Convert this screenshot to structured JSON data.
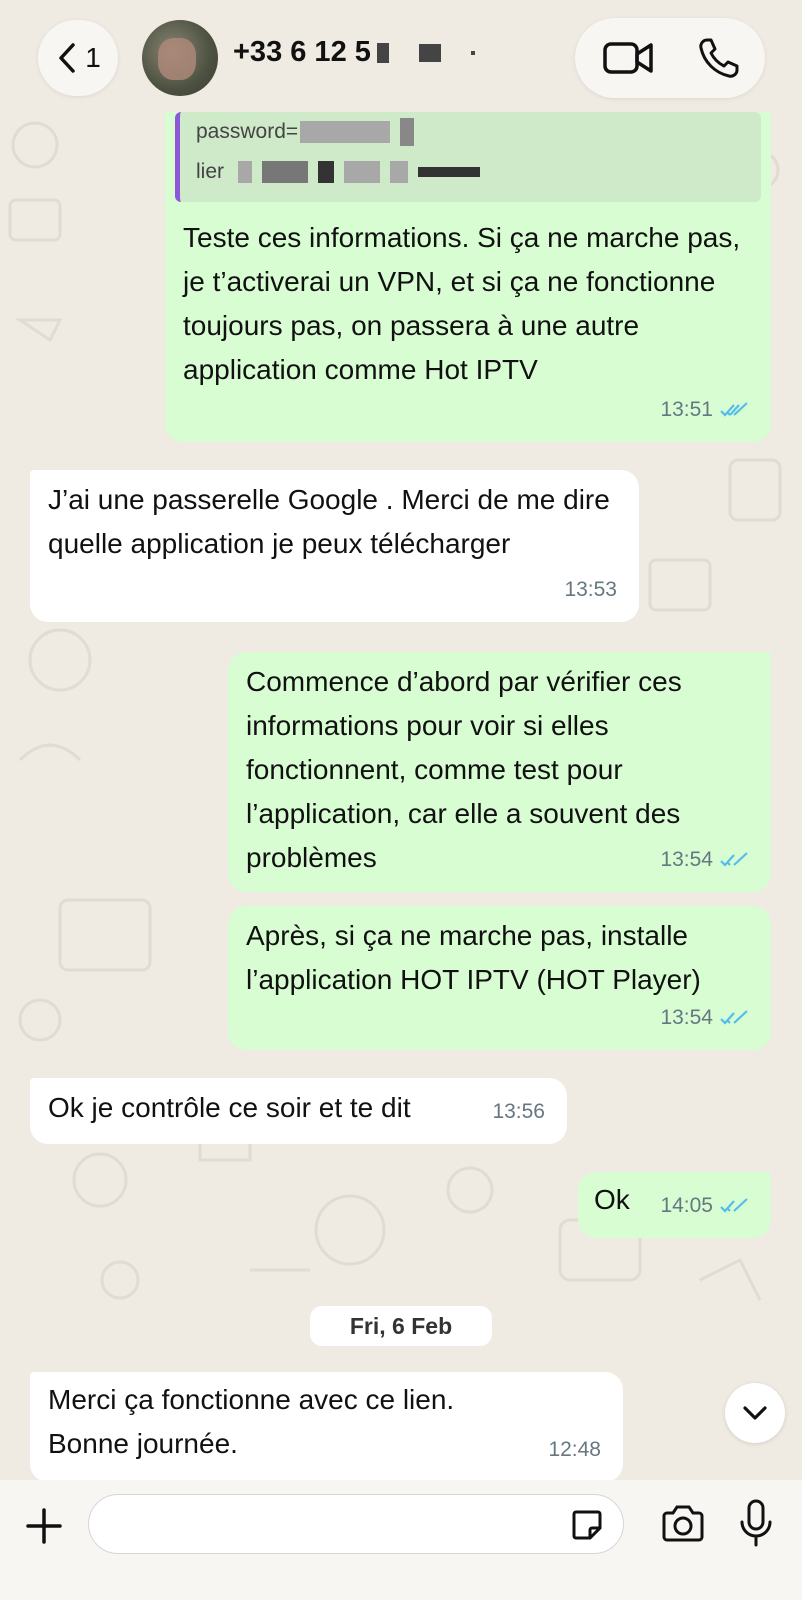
{
  "header": {
    "back_count": "1",
    "contact_phone": "+33 6 12 5"
  },
  "messages": [
    {
      "id": "m1",
      "quoted_lines": [
        "password=",
        "lier"
      ],
      "text": "Teste ces informations. Si ça ne marche pas, je t’activerai un VPN, et si ça ne fonctionne toujours pas, on passera à une autre application comme Hot IPTV",
      "time": "13:51",
      "direction": "outgoing"
    },
    {
      "id": "m2",
      "text": "J’ai une passerelle Google . Merci de me dire quelle application je peux télécharger",
      "time": "13:53",
      "direction": "incoming"
    },
    {
      "id": "m3",
      "text": "Commence d’abord par vérifier ces informations pour voir si elles fonctionnent, comme test pour l’application, car elle a souvent des problèmes",
      "time": "13:54",
      "direction": "outgoing"
    },
    {
      "id": "m4",
      "text": "Après, si ça ne marche pas, installe l’application HOT IPTV (HOT Player)",
      "time": "13:54",
      "direction": "outgoing"
    },
    {
      "id": "m5",
      "text": "Ok je contrôle ce soir et te dit",
      "time": "13:56",
      "direction": "incoming"
    },
    {
      "id": "m6",
      "text": "Ok",
      "time": "14:05",
      "direction": "outgoing"
    },
    {
      "id": "m7",
      "text": "Merci ça fonctionne avec  ce lien.\nBonne journée.",
      "time": "12:48",
      "direction": "incoming"
    }
  ],
  "date_separator": "Fri, 6 Feb",
  "composer": {
    "placeholder": ""
  },
  "colors": {
    "background": "#efeae2",
    "outgoing_bubble": "#d9fdd3",
    "incoming_bubble": "#ffffff",
    "read_ticks": "#53bdeb",
    "quote_bar": "#8e59d8"
  },
  "icons": [
    "back-chevron-icon",
    "video-call-icon",
    "voice-call-icon",
    "read-ticks-icon",
    "scroll-down-icon",
    "plus-icon",
    "sticker-icon",
    "camera-icon",
    "microphone-icon"
  ]
}
